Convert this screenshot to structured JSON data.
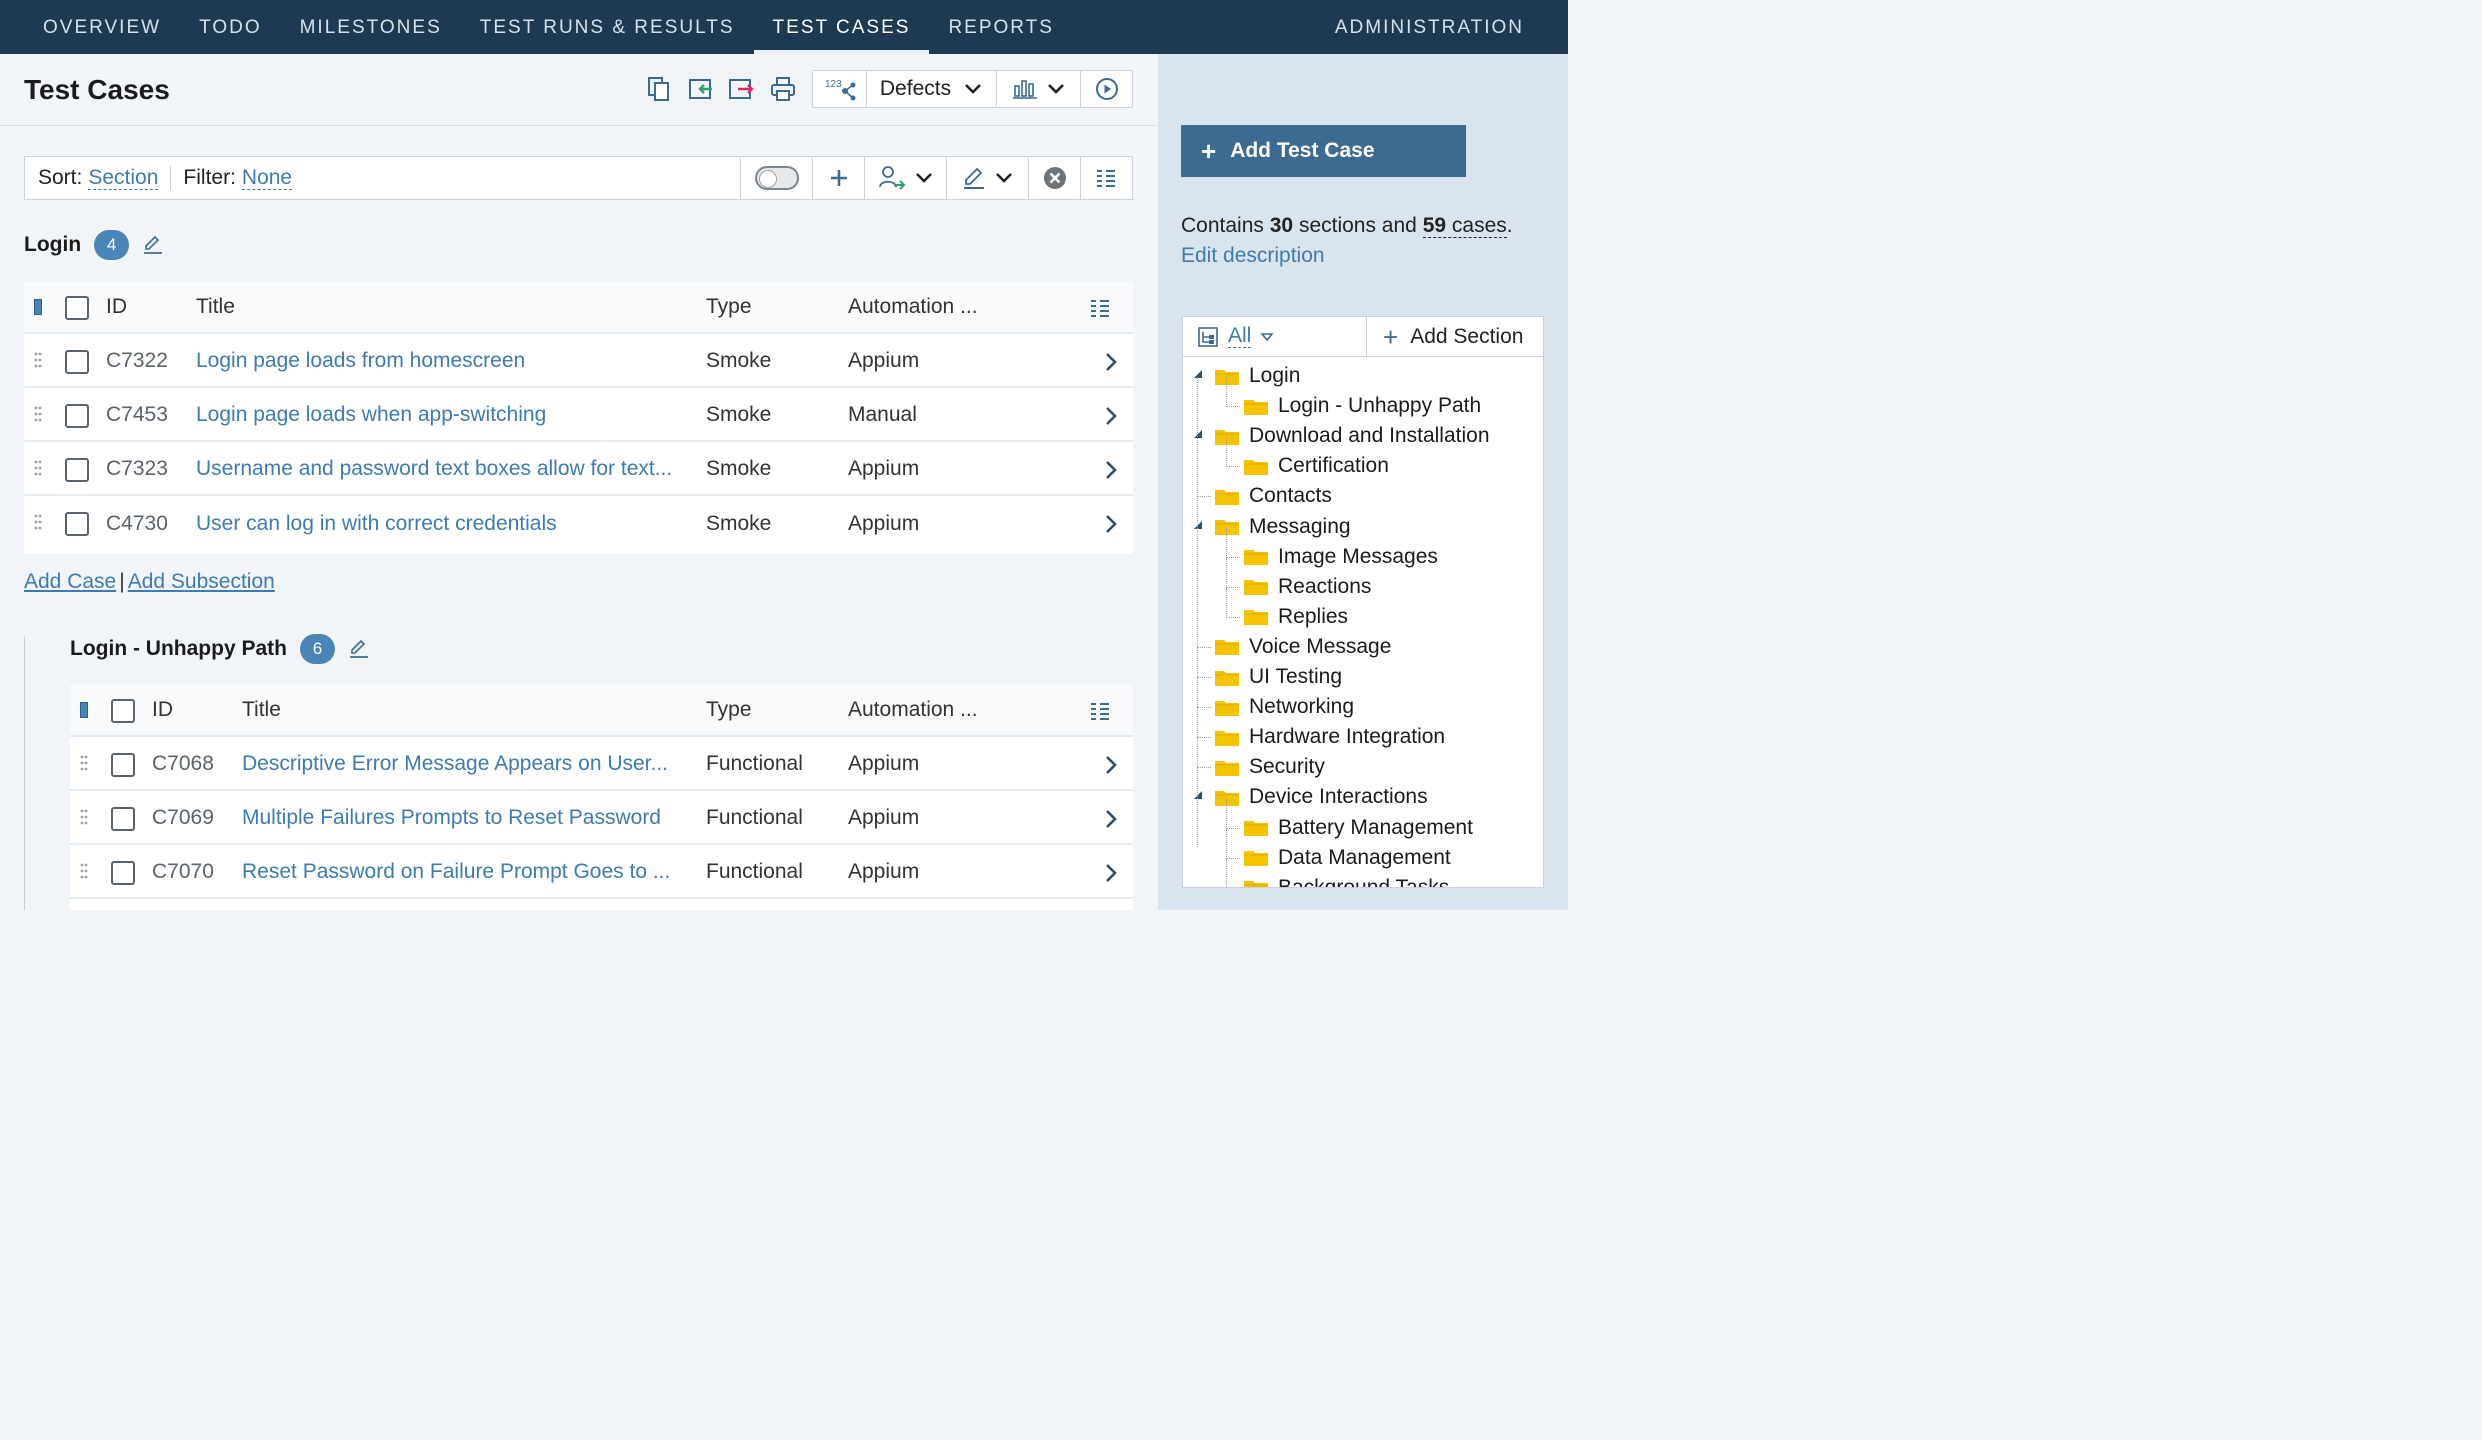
{
  "nav": {
    "items": [
      "OVERVIEW",
      "TODO",
      "MILESTONES",
      "TEST RUNS & RESULTS",
      "TEST CASES",
      "REPORTS"
    ],
    "active": "TEST CASES",
    "admin": "ADMINISTRATION"
  },
  "page": {
    "title": "Test Cases"
  },
  "toolbar": {
    "defects_label": "Defects",
    "sequence_icon_label": "123"
  },
  "filter": {
    "sort_label": "Sort:",
    "sort_value": "Section",
    "filter_label": "Filter:",
    "filter_value": "None"
  },
  "columns": {
    "id": "ID",
    "title": "Title",
    "type": "Type",
    "automation": "Automation ..."
  },
  "sections": [
    {
      "name": "Login",
      "count": "4",
      "rows": [
        {
          "id": "C7322",
          "title": "Login page loads from homescreen",
          "type": "Smoke",
          "automation": "Appium"
        },
        {
          "id": "C7453",
          "title": "Login page loads when app-switching",
          "type": "Smoke",
          "automation": "Manual"
        },
        {
          "id": "C7323",
          "title": "Username and password text boxes allow for text...",
          "type": "Smoke",
          "automation": "Appium"
        },
        {
          "id": "C4730",
          "title": "User can log in with correct credentials",
          "type": "Smoke",
          "automation": "Appium"
        }
      ]
    },
    {
      "name": "Login - Unhappy Path",
      "count": "6",
      "rows": [
        {
          "id": "C7068",
          "title": "Descriptive Error Message Appears on User...",
          "type": "Functional",
          "automation": "Appium"
        },
        {
          "id": "C7069",
          "title": "Multiple Failures Prompts to Reset Password",
          "type": "Functional",
          "automation": "Appium"
        },
        {
          "id": "C7070",
          "title": "Reset Password on Failure Prompt Goes to ...",
          "type": "Functional",
          "automation": "Appium"
        }
      ]
    }
  ],
  "add_links": {
    "add_case": "Add Case",
    "separator": "|",
    "add_subsection": "Add Subsection"
  },
  "sidebar": {
    "add_button": "Add Test Case",
    "contains_prefix": "Contains",
    "sections_count": "30",
    "contains_middle": "sections and",
    "cases_count": "59",
    "cases_word": "cases",
    "contains_suffix": ".",
    "edit_description": "Edit description",
    "tree_filter": "All",
    "add_section": "Add Section",
    "tree": [
      {
        "label": "Login",
        "level": 0,
        "expanded": true
      },
      {
        "label": "Login - Unhappy Path",
        "level": 1
      },
      {
        "label": "Download and Installation",
        "level": 0,
        "expanded": true
      },
      {
        "label": "Certification",
        "level": 1
      },
      {
        "label": "Contacts",
        "level": 0
      },
      {
        "label": "Messaging",
        "level": 0,
        "expanded": true
      },
      {
        "label": "Image Messages",
        "level": 1
      },
      {
        "label": "Reactions",
        "level": 1
      },
      {
        "label": "Replies",
        "level": 1
      },
      {
        "label": "Voice Message",
        "level": 0
      },
      {
        "label": "UI Testing",
        "level": 0
      },
      {
        "label": "Networking",
        "level": 0
      },
      {
        "label": "Hardware Integration",
        "level": 0
      },
      {
        "label": "Security",
        "level": 0
      },
      {
        "label": "Device Interactions",
        "level": 0,
        "expanded": true
      },
      {
        "label": "Battery Management",
        "level": 1
      },
      {
        "label": "Data Management",
        "level": 1
      },
      {
        "label": "Background Tasks",
        "level": 1
      }
    ]
  },
  "colors": {
    "nav_bg": "#1d3a52",
    "link": "#3d7bb0",
    "badge": "#4a85b8",
    "button": "#3c6a91",
    "folder": "#f5c400"
  }
}
